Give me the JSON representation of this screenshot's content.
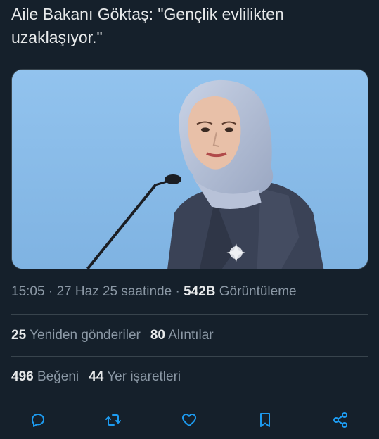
{
  "tweet": {
    "text": "Aile Bakanı Göktaş: \"Gençlik evlilikten\nuzaklaşıyor.\""
  },
  "media": {
    "description_icon": "photo"
  },
  "meta": {
    "time": "15:05",
    "separator1": " · ",
    "date": "27 Haz 25 saatinde",
    "separator2": " · ",
    "views_count": "542B",
    "views_label": "Görüntüleme"
  },
  "stats": {
    "reposts_count": "25",
    "reposts_label": "Yeniden gönderiler",
    "quotes_count": "80",
    "quotes_label": "Alıntılar",
    "likes_count": "496",
    "likes_label": "Beğeni",
    "bookmarks_count": "44",
    "bookmarks_label": "Yer işaretleri"
  },
  "actions": {
    "reply_icon": "reply-icon",
    "repost_icon": "repost-icon",
    "like_icon": "heart-icon",
    "bookmark_icon": "bookmark-icon",
    "share_icon": "share-icon"
  },
  "colors": {
    "background": "#15202b",
    "text_primary": "#e7e9ea",
    "text_secondary": "#8b98a5",
    "accent": "#1d9bf0",
    "divider": "#38444d"
  }
}
